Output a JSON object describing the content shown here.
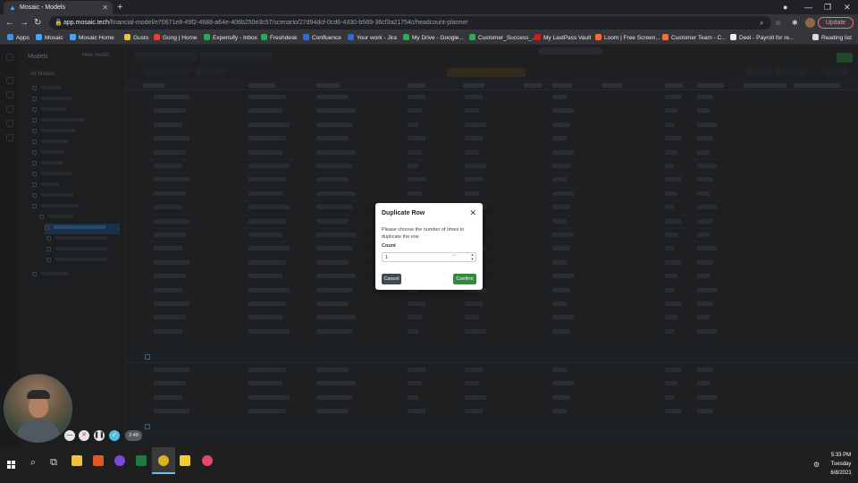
{
  "browser": {
    "tab_title": "Mosaic - Models",
    "url_host": "app.mosaic.tech",
    "url_path": "/financial-model/e70671e8-49f2-4688-a64e-406b250e3c57/scenario/27d94dcf-0cd6-4330-b569-36cf3a21754c/headcount-planner",
    "update_label": "Update",
    "bookmarks": [
      "Apps",
      "Mosaic",
      "Mosaic Home",
      "Gusto",
      "Gong | Home",
      "Expensify - Inbox",
      "Freshdesk",
      "Confluence",
      "Your work - Jira",
      "My Drive - Google...",
      "Customer_Success_...",
      "My LastPass Vault",
      "Loom | Free Screen...",
      "Customer Team - C...",
      "Deel - Payroll for re...",
      "Reading list"
    ],
    "bookmark_colors": [
      "#4a90d9",
      "#4aa3ff",
      "#4aa3ff",
      "#f0c040",
      "#e04040",
      "#2aa860",
      "#2aa860",
      "#2f6bd8",
      "#2f6bd8",
      "#34a853",
      "#34a853",
      "#cc2020",
      "#ff6a3d",
      "#ff6a3d",
      "#eeeeee",
      "#dddddd"
    ]
  },
  "app": {
    "sidebar_title": "Models",
    "sidebar_button": "New model",
    "sidebar_subtitle": "All Models"
  },
  "modal": {
    "title": "Duplicate Row",
    "description": "Please choose the number of times to duplicate the row",
    "count_label": "Count",
    "count_value": "1",
    "cancel_label": "Cancel",
    "confirm_label": "Confirm",
    "close_glyph": "✕"
  },
  "recorder": {
    "time": "2:49"
  },
  "taskbar": {
    "time": "5:33 PM",
    "day": "Tuesday",
    "date": "6/8/2021"
  },
  "colors": {
    "confirm": "#2f8a3d",
    "cancel": "#3e4953",
    "update": "#ff6b6b"
  }
}
